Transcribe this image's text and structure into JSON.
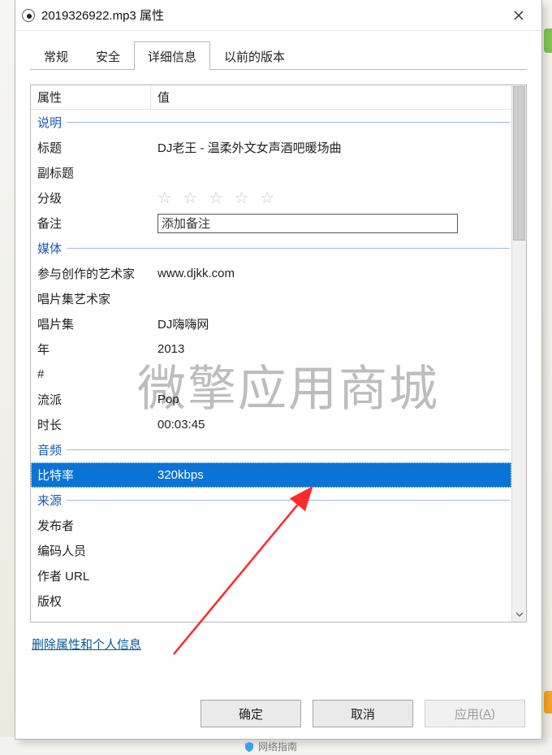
{
  "window": {
    "title": "2019326922.mp3 属性",
    "close_tooltip": "关闭"
  },
  "tabs": [
    {
      "id": "general",
      "label": "常规"
    },
    {
      "id": "security",
      "label": "安全"
    },
    {
      "id": "details",
      "label": "详细信息",
      "active": true
    },
    {
      "id": "previous",
      "label": "以前的版本"
    }
  ],
  "grid": {
    "header": {
      "col1": "属性",
      "col2": "值"
    },
    "sections": {
      "description": "说明",
      "media": "媒体",
      "audio": "音频",
      "origin": "来源"
    },
    "rows": {
      "title": {
        "label": "标题",
        "value": "DJ老王 - 温柔外文女声酒吧暖场曲"
      },
      "subtitle": {
        "label": "副标题",
        "value": ""
      },
      "rating": {
        "label": "分级",
        "value": "☆ ☆ ☆ ☆ ☆"
      },
      "comment": {
        "label": "备注",
        "value": "添加备注"
      },
      "artist": {
        "label": "参与创作的艺术家",
        "value": "www.djkk.com"
      },
      "albumartist": {
        "label": "唱片集艺术家",
        "value": ""
      },
      "album": {
        "label": "唱片集",
        "value": "DJ嗨嗨网"
      },
      "year": {
        "label": "年",
        "value": "2013"
      },
      "track": {
        "label": "#",
        "value": ""
      },
      "genre": {
        "label": "流派",
        "value": "Pop"
      },
      "length": {
        "label": "时长",
        "value": "00:03:45"
      },
      "bitrate": {
        "label": "比特率",
        "value": "320kbps"
      },
      "publisher": {
        "label": "发布者",
        "value": ""
      },
      "encodedby": {
        "label": "编码人员",
        "value": ""
      },
      "authorurl": {
        "label": "作者 URL",
        "value": ""
      },
      "copyright": {
        "label": "版权",
        "value": ""
      }
    }
  },
  "link_remove": "删除属性和个人信息",
  "buttons": {
    "ok": "确定",
    "cancel": "取消",
    "apply": "应用",
    "apply_key": "A"
  },
  "watermark": "微擎应用商城",
  "taskbar_hint": "网络指南"
}
